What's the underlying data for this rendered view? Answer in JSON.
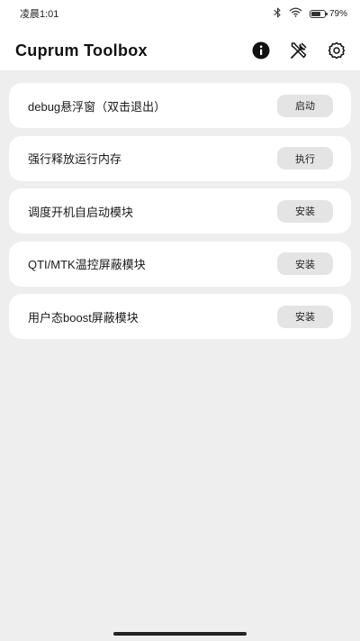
{
  "status_bar": {
    "time": "凌晨1:01",
    "battery_text": "79%",
    "battery_level": 0.79
  },
  "app": {
    "title": "Cuprum Toolbox",
    "actions": [
      {
        "icon": "info-icon"
      },
      {
        "icon": "tools-icon"
      },
      {
        "icon": "gear-icon"
      }
    ]
  },
  "items": [
    {
      "label": "debug悬浮窗（双击退出）",
      "button": "启动"
    },
    {
      "label": "强行释放运行内存",
      "button": "执行"
    },
    {
      "label": "调度开机自启动模块",
      "button": "安装"
    },
    {
      "label": "QTI/MTK温控屏蔽模块",
      "button": "安装"
    },
    {
      "label": "用户态boost屏蔽模块",
      "button": "安装"
    }
  ]
}
